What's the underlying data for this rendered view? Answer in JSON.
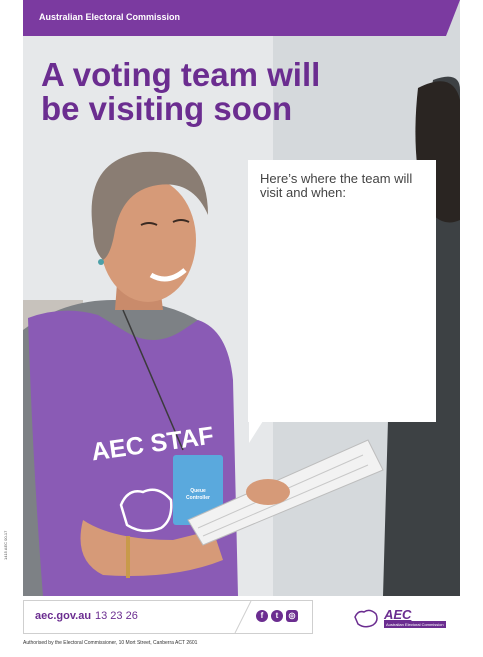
{
  "banner": {
    "org": "Australian Electoral Commission"
  },
  "headline": {
    "line1": "A voting team will",
    "line2": "be visiting soon"
  },
  "callout": {
    "text": "Here’s where the team will visit and when:"
  },
  "bib": {
    "text": "AEC STAF"
  },
  "badge": {
    "line1": "Queue",
    "line2": "Controller"
  },
  "reference_code": "1415 AEC 00-17",
  "footer": {
    "url": "aec.gov.au",
    "phone": "13 23 26",
    "social_icons": [
      "facebook-icon",
      "twitter-icon",
      "instagram-icon"
    ],
    "authorised": "Authorised by the Electoral Commissioner, 10 Mort Street, Canberra ACT 2601"
  },
  "logo": {
    "word": "AEC",
    "subtitle": "Australian Electoral Commission"
  },
  "colors": {
    "brand_purple": "#6b2d90",
    "banner_purple": "#7b3aa0",
    "bib_purple": "#8a5bb5"
  }
}
